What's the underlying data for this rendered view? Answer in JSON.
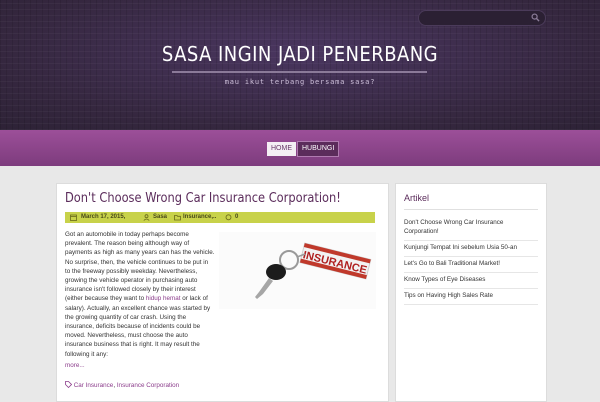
{
  "header": {
    "site_title": "SASA INGIN JADI PENERBANG",
    "tagline": "mau ikut terbang bersama sasa?",
    "search_placeholder": ""
  },
  "nav": {
    "items": [
      {
        "label": "HOME"
      },
      {
        "label": "HUBUNGI"
      }
    ]
  },
  "post": {
    "title": "Don't Choose Wrong Car Insurance Corporation!",
    "meta": {
      "date": "March 17, 2015,",
      "author": "Sasa",
      "category": "Insurance,..",
      "comments": "0"
    },
    "image_label": "INSURANCE",
    "para1": "Got an automobile in today perhaps become prevalent. The reason being although way of payments as high as many years can has the vehicle. No surprise, then, the vehicle continues to be put in to the freeway possibly weekday. Nevertheless, growing the vehicle operator in purchasing auto insurance isn't followed closely by their interest (either because they want to",
    "link_text": "hidup hemat",
    "para1b": " or lack of salary). Actually, an excellent chance was started by the growing quantity of car crash. Using the insurance, deficits because of incidents could be moved. Nevertheless, must choose the auto insurance business that is right. It may result the following it any:",
    "more": "more...",
    "tags": [
      "Car Insurance",
      "Insurance Corporation"
    ],
    "tag_sep": ", "
  },
  "sidebar": {
    "title": "Artikel",
    "items": [
      "Don't Choose Wrong Car Insurance Corporation!",
      "Kunjungi Tempat Ini sebelum Usia 50-an",
      "Let's Go to Bali Traditional Market!",
      "Know Types of Eye Diseases",
      "Tips on Having High Sales Rate"
    ]
  },
  "colors": {
    "header_bg": "#3a2b4a",
    "nav_bg": "#8e4590",
    "meta_bar": "#c8d24a",
    "accent": "#5b2c5b"
  }
}
